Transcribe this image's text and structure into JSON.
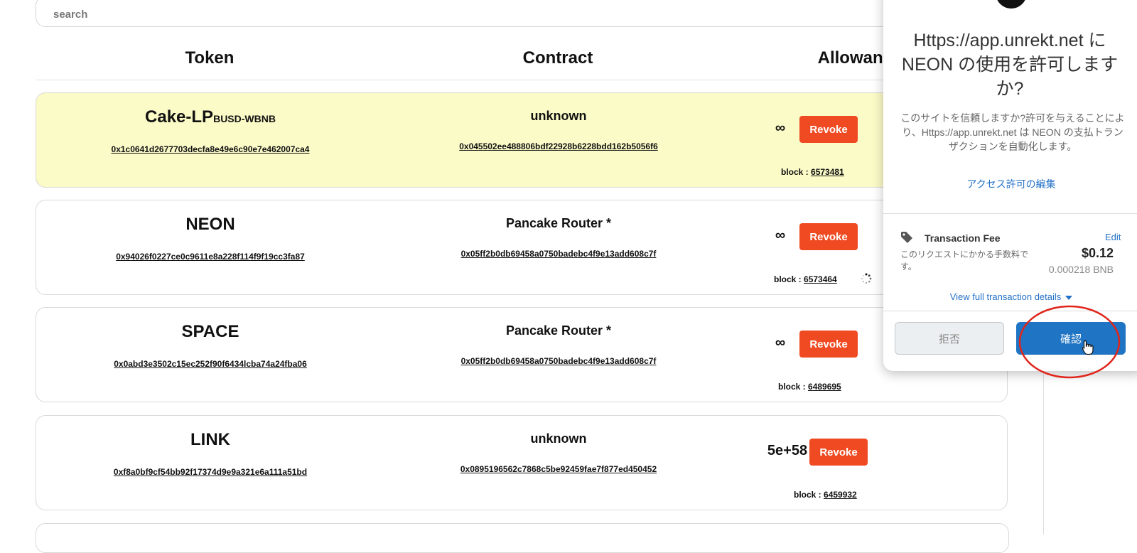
{
  "search": {
    "placeholder": "search"
  },
  "headers": {
    "token": "Token",
    "contract": "Contract",
    "allowance": "Allowance"
  },
  "rows": [
    {
      "token_name": "Cake-LP",
      "token_sub": "BUSD-WBNB",
      "token_addr": "0x1c0641d2677703decfa8e49e6c90e7e462007ca4",
      "contract_name": "unknown",
      "contract_addr": "0x045502ee488806bdf22928b6228bdd162b5056f6",
      "allowance": "∞",
      "revoke": "Revoke",
      "block_label": "block :",
      "block_num": "6573481",
      "highlight": true
    },
    {
      "token_name": "NEON",
      "token_addr": "0x94026f0227ce0c9611e8a228f114f9f19cc3fa87",
      "contract_name": "Pancake Router *",
      "contract_addr": "0x05ff2b0db69458a0750badebc4f9e13add608c7f",
      "allowance": "∞",
      "revoke": "Revoke",
      "block_label": "block :",
      "block_num": "6573464",
      "highlight": false
    },
    {
      "token_name": "SPACE",
      "token_addr": "0x0abd3e3502c15ec252f90f6434lcba74a24fba06",
      "contract_name": "Pancake Router *",
      "contract_addr": "0x05ff2b0db69458a0750badebc4f9e13add608c7f",
      "allowance": "∞",
      "revoke": "Revoke",
      "block_label": "block :",
      "block_num": "6489695",
      "highlight": false
    },
    {
      "token_name": "LINK",
      "token_addr": "0xf8a0bf9cf54bb92f17374d9e9a321e6a111a51bd",
      "contract_name": "unknown",
      "contract_addr": "0x0895196562c7868c5be92459fae7f877ed450452",
      "allowance": "5e+58",
      "revoke": "Revoke",
      "block_label": "block :",
      "block_num": "6459932",
      "highlight": false
    }
  ],
  "popup": {
    "title": "Https://app.unrekt.net に NEON の使用を許可しますか?",
    "description": "このサイトを信頼しますか?許可を与えることにより、Https://app.unrekt.net は NEON の支払トランザクションを自動化します。",
    "edit_permission": "アクセス許可の編集",
    "fee_title": "Transaction Fee",
    "fee_edit": "Edit",
    "fee_note": "このリクエストにかかる手数料です。",
    "fee_usd": "$0.12",
    "fee_bnb": "0.000218 BNB",
    "details_link": "View full transaction details",
    "reject": "拒否",
    "confirm": "確認"
  },
  "colors": {
    "revoke": "#ef4a22",
    "confirm": "#1f74c3",
    "link": "#2472c8",
    "highlight_row": "#fbfbc8",
    "annotation_circle": "#e0251b"
  }
}
